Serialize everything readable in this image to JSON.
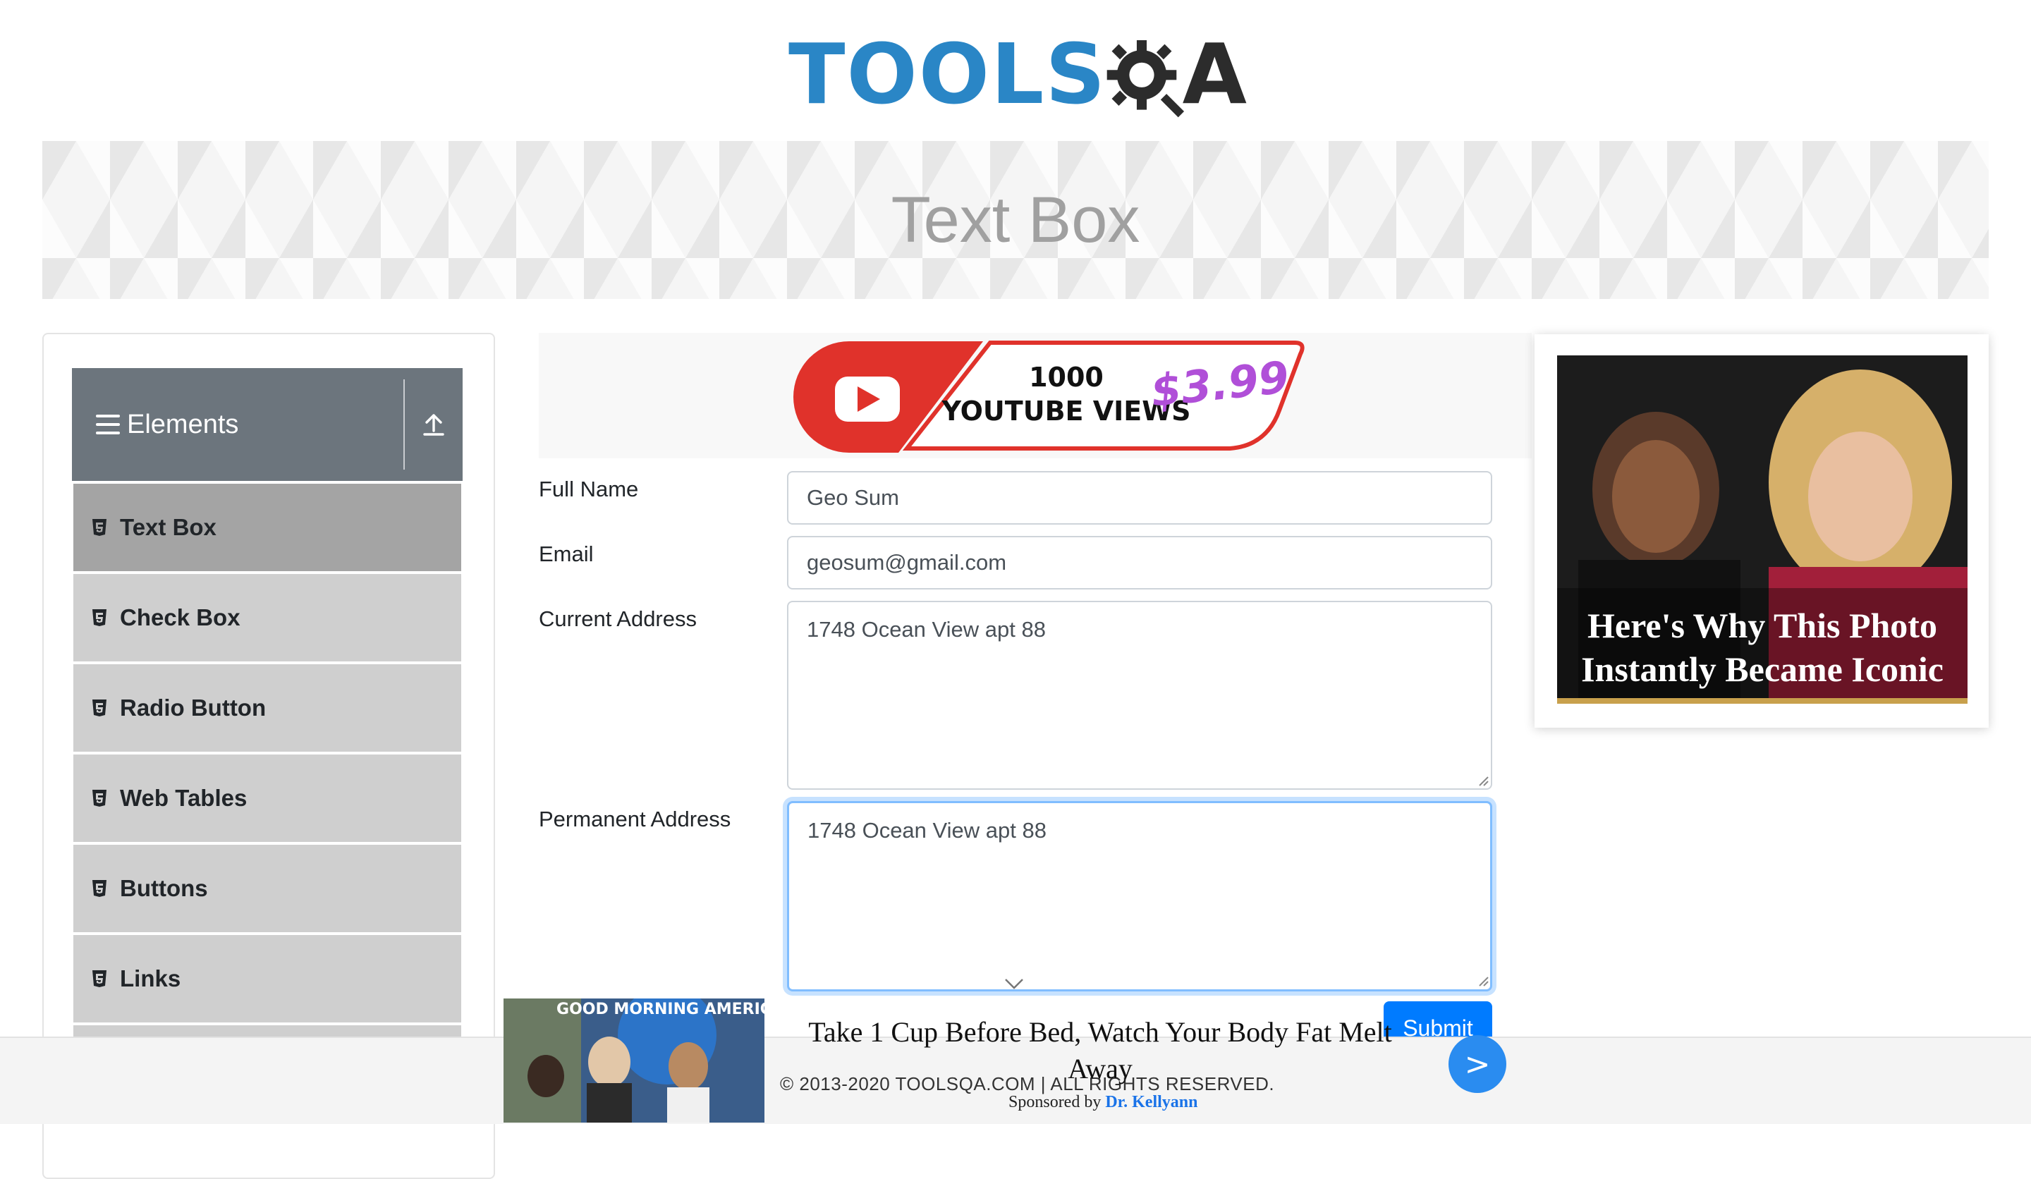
{
  "logo": {
    "text_main": "TOOLS",
    "text_end": "A",
    "brand_color": "#2a86c6"
  },
  "banner": {
    "title": "Text Box"
  },
  "sidebar": {
    "group_title": "Elements",
    "items": [
      {
        "label": "Text Box",
        "active": true
      },
      {
        "label": "Check Box"
      },
      {
        "label": "Radio Button"
      },
      {
        "label": "Web Tables"
      },
      {
        "label": "Buttons"
      },
      {
        "label": "Links"
      }
    ]
  },
  "top_ad": {
    "line1": "1000",
    "line2": "YOUTUBE VIEWS",
    "price": "$3.99"
  },
  "form": {
    "full_name": {
      "label": "Full Name",
      "value": "Geo Sum"
    },
    "email": {
      "label": "Email",
      "value": "geosum@gmail.com"
    },
    "current_address": {
      "label": "Current Address",
      "value": "1748 Ocean View apt 88"
    },
    "permanent_address": {
      "label": "Permanent Address",
      "value": "1748 Ocean View apt 88"
    },
    "submit_label": "Submit"
  },
  "right_ad": {
    "caption": "Here's Why This Photo Instantly Became Iconic"
  },
  "bottom_ad": {
    "image_text": "GOOD MORNING AMERICA",
    "title": "Take 1 Cup Before Bed, Watch Your Body Fat Melt Away",
    "sponsor_prefix": "Sponsored by",
    "sponsor_name": "Dr. Kellyann",
    "next_label": ">"
  },
  "footer": {
    "copyright": "© 2013-2020 TOOLSQA.COM | ALL RIGHTS RESERVED."
  },
  "colors": {
    "primary": "#007bff",
    "nav_header": "#6c757d",
    "nav_item": "#cfcfcf",
    "nav_active": "#a4a4a4"
  }
}
